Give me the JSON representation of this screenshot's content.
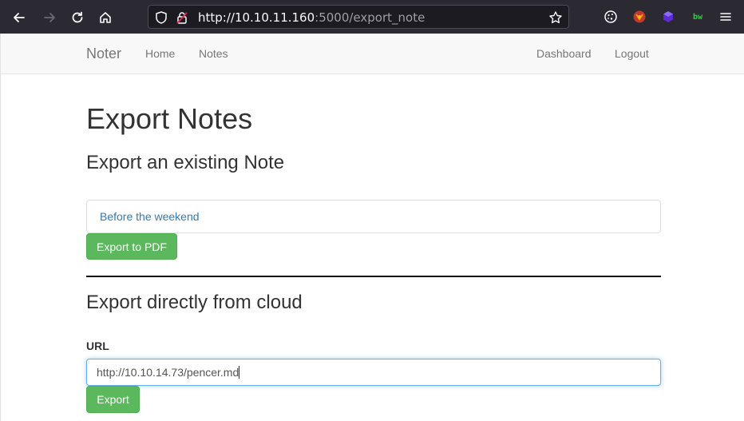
{
  "browser": {
    "url_host": "http://10.10.11.160",
    "url_rest": ":5000/export_note",
    "icons": [
      "back-icon",
      "forward-icon",
      "reload-icon",
      "home-icon",
      "shield-icon",
      "lock-icon",
      "star-icon",
      "cookie-icon",
      "fox-extension-icon",
      "purple-cube-extension-icon",
      "bw-extension-icon",
      "menu-icon"
    ],
    "bw_label": "bw"
  },
  "navbar": {
    "brand": "Noter",
    "left_links": [
      "Home",
      "Notes"
    ],
    "right_links": [
      "Dashboard",
      "Logout"
    ]
  },
  "main": {
    "title": "Export Notes",
    "section1_heading": "Export an existing Note",
    "selected_note": "Before the weekend",
    "export_pdf_label": "Export to PDF",
    "section2_heading": "Export directly from cloud",
    "url_label": "URL",
    "url_value": "http://10.10.14.73/pencer.md",
    "export_label": "Export"
  },
  "colors": {
    "success": "#5cb85c",
    "link": "#337ab7",
    "chrome_bg": "#2b2a33"
  }
}
